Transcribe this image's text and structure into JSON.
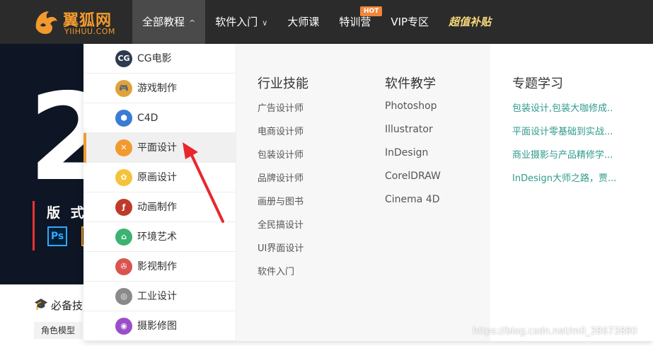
{
  "logo": {
    "name_cn": "翼狐网",
    "name_en": "YIIHUU.COM"
  },
  "nav": {
    "items": [
      {
        "label": "全部教程",
        "chevron": "^"
      },
      {
        "label": "软件入门",
        "chevron": "∨"
      },
      {
        "label": "大师课"
      },
      {
        "label": "特训营",
        "badge": "HOT"
      },
      {
        "label": "VIP专区"
      },
      {
        "label": "超值补贴"
      }
    ]
  },
  "hero": {
    "big_text": "2",
    "title": "版 式",
    "ps_label": "Ps"
  },
  "lower": {
    "section_title": "必备技",
    "tag": "角色模型"
  },
  "dropdown": {
    "categories": [
      {
        "label": "CG电影",
        "icon": "cg-icon",
        "glyph": "CG",
        "color": "#2e3a4d"
      },
      {
        "label": "游戏制作",
        "icon": "gamepad-icon",
        "glyph": "🎮",
        "color": "#e0a33c"
      },
      {
        "label": "C4D",
        "icon": "cube-icon",
        "glyph": "⬢",
        "color": "#3a7bd5"
      },
      {
        "label": "平面设计",
        "icon": "design-tools-icon",
        "glyph": "✕",
        "color": "#f29a2e"
      },
      {
        "label": "原画设计",
        "icon": "palette-icon",
        "glyph": "✿",
        "color": "#f5c33b"
      },
      {
        "label": "动画制作",
        "icon": "flash-icon",
        "glyph": "ƒ",
        "color": "#c0392b"
      },
      {
        "label": "环境艺术",
        "icon": "house-icon",
        "glyph": "⌂",
        "color": "#3cb371"
      },
      {
        "label": "影视制作",
        "icon": "film-reel-icon",
        "glyph": "✇",
        "color": "#d9534f"
      },
      {
        "label": "工业设计",
        "icon": "ring-icon",
        "glyph": "◎",
        "color": "#8a8a8a"
      },
      {
        "label": "摄影修图",
        "icon": "camera-icon",
        "glyph": "◉",
        "color": "#9b4dca"
      }
    ],
    "industry": {
      "title": "行业技能",
      "links": [
        "广告设计师",
        "电商设计师",
        "包装设计师",
        "品牌设计师",
        "画册与图书",
        "全民搞设计",
        "UI界面设计",
        "软件入门"
      ]
    },
    "software": {
      "title": "软件教学",
      "links": [
        "Photoshop",
        "Illustrator",
        "InDesign",
        "CorelDRAW",
        "Cinema 4D"
      ]
    },
    "topics": {
      "title": "专题学习",
      "links": [
        "包装设计,包装大咖修成..",
        "平面设计零基础到实战...",
        "商业摄影与产品精修学...",
        "InDesign大师之路，贾..."
      ]
    }
  },
  "watermark": "https://blog.csdn.net/m0_38673880",
  "colors": {
    "accent": "#f29a2e",
    "nav_bg": "#2b2b2b",
    "topic_link": "#2f9a8c",
    "arrow": "#e8262d"
  }
}
